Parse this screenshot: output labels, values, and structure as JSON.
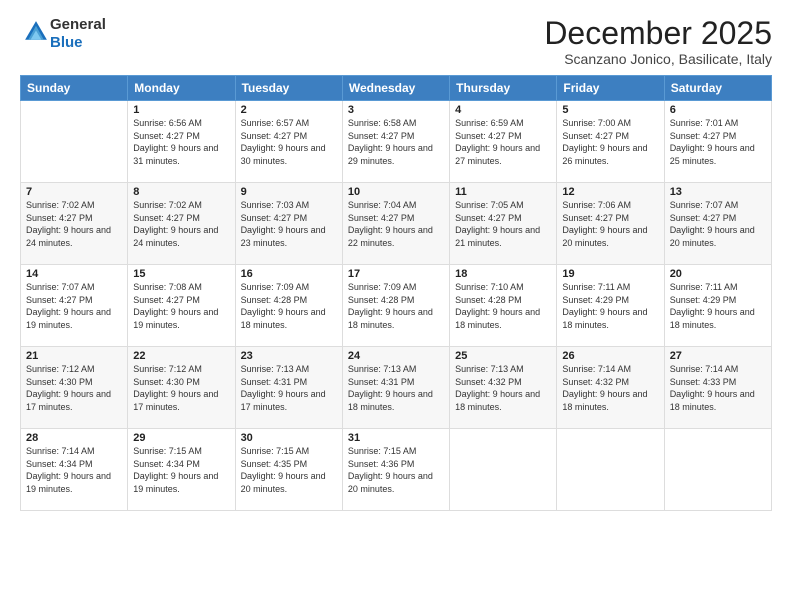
{
  "logo": {
    "general": "General",
    "blue": "Blue"
  },
  "title": "December 2025",
  "location": "Scanzano Jonico, Basilicate, Italy",
  "days_of_week": [
    "Sunday",
    "Monday",
    "Tuesday",
    "Wednesday",
    "Thursday",
    "Friday",
    "Saturday"
  ],
  "weeks": [
    [
      {
        "day": "",
        "sunrise": "",
        "sunset": "",
        "daylight": ""
      },
      {
        "day": "1",
        "sunrise": "Sunrise: 6:56 AM",
        "sunset": "Sunset: 4:27 PM",
        "daylight": "Daylight: 9 hours and 31 minutes."
      },
      {
        "day": "2",
        "sunrise": "Sunrise: 6:57 AM",
        "sunset": "Sunset: 4:27 PM",
        "daylight": "Daylight: 9 hours and 30 minutes."
      },
      {
        "day": "3",
        "sunrise": "Sunrise: 6:58 AM",
        "sunset": "Sunset: 4:27 PM",
        "daylight": "Daylight: 9 hours and 29 minutes."
      },
      {
        "day": "4",
        "sunrise": "Sunrise: 6:59 AM",
        "sunset": "Sunset: 4:27 PM",
        "daylight": "Daylight: 9 hours and 27 minutes."
      },
      {
        "day": "5",
        "sunrise": "Sunrise: 7:00 AM",
        "sunset": "Sunset: 4:27 PM",
        "daylight": "Daylight: 9 hours and 26 minutes."
      },
      {
        "day": "6",
        "sunrise": "Sunrise: 7:01 AM",
        "sunset": "Sunset: 4:27 PM",
        "daylight": "Daylight: 9 hours and 25 minutes."
      }
    ],
    [
      {
        "day": "7",
        "sunrise": "Sunrise: 7:02 AM",
        "sunset": "Sunset: 4:27 PM",
        "daylight": "Daylight: 9 hours and 24 minutes."
      },
      {
        "day": "8",
        "sunrise": "Sunrise: 7:02 AM",
        "sunset": "Sunset: 4:27 PM",
        "daylight": "Daylight: 9 hours and 24 minutes."
      },
      {
        "day": "9",
        "sunrise": "Sunrise: 7:03 AM",
        "sunset": "Sunset: 4:27 PM",
        "daylight": "Daylight: 9 hours and 23 minutes."
      },
      {
        "day": "10",
        "sunrise": "Sunrise: 7:04 AM",
        "sunset": "Sunset: 4:27 PM",
        "daylight": "Daylight: 9 hours and 22 minutes."
      },
      {
        "day": "11",
        "sunrise": "Sunrise: 7:05 AM",
        "sunset": "Sunset: 4:27 PM",
        "daylight": "Daylight: 9 hours and 21 minutes."
      },
      {
        "day": "12",
        "sunrise": "Sunrise: 7:06 AM",
        "sunset": "Sunset: 4:27 PM",
        "daylight": "Daylight: 9 hours and 20 minutes."
      },
      {
        "day": "13",
        "sunrise": "Sunrise: 7:07 AM",
        "sunset": "Sunset: 4:27 PM",
        "daylight": "Daylight: 9 hours and 20 minutes."
      }
    ],
    [
      {
        "day": "14",
        "sunrise": "Sunrise: 7:07 AM",
        "sunset": "Sunset: 4:27 PM",
        "daylight": "Daylight: 9 hours and 19 minutes."
      },
      {
        "day": "15",
        "sunrise": "Sunrise: 7:08 AM",
        "sunset": "Sunset: 4:27 PM",
        "daylight": "Daylight: 9 hours and 19 minutes."
      },
      {
        "day": "16",
        "sunrise": "Sunrise: 7:09 AM",
        "sunset": "Sunset: 4:28 PM",
        "daylight": "Daylight: 9 hours and 18 minutes."
      },
      {
        "day": "17",
        "sunrise": "Sunrise: 7:09 AM",
        "sunset": "Sunset: 4:28 PM",
        "daylight": "Daylight: 9 hours and 18 minutes."
      },
      {
        "day": "18",
        "sunrise": "Sunrise: 7:10 AM",
        "sunset": "Sunset: 4:28 PM",
        "daylight": "Daylight: 9 hours and 18 minutes."
      },
      {
        "day": "19",
        "sunrise": "Sunrise: 7:11 AM",
        "sunset": "Sunset: 4:29 PM",
        "daylight": "Daylight: 9 hours and 18 minutes."
      },
      {
        "day": "20",
        "sunrise": "Sunrise: 7:11 AM",
        "sunset": "Sunset: 4:29 PM",
        "daylight": "Daylight: 9 hours and 18 minutes."
      }
    ],
    [
      {
        "day": "21",
        "sunrise": "Sunrise: 7:12 AM",
        "sunset": "Sunset: 4:30 PM",
        "daylight": "Daylight: 9 hours and 17 minutes."
      },
      {
        "day": "22",
        "sunrise": "Sunrise: 7:12 AM",
        "sunset": "Sunset: 4:30 PM",
        "daylight": "Daylight: 9 hours and 17 minutes."
      },
      {
        "day": "23",
        "sunrise": "Sunrise: 7:13 AM",
        "sunset": "Sunset: 4:31 PM",
        "daylight": "Daylight: 9 hours and 17 minutes."
      },
      {
        "day": "24",
        "sunrise": "Sunrise: 7:13 AM",
        "sunset": "Sunset: 4:31 PM",
        "daylight": "Daylight: 9 hours and 18 minutes."
      },
      {
        "day": "25",
        "sunrise": "Sunrise: 7:13 AM",
        "sunset": "Sunset: 4:32 PM",
        "daylight": "Daylight: 9 hours and 18 minutes."
      },
      {
        "day": "26",
        "sunrise": "Sunrise: 7:14 AM",
        "sunset": "Sunset: 4:32 PM",
        "daylight": "Daylight: 9 hours and 18 minutes."
      },
      {
        "day": "27",
        "sunrise": "Sunrise: 7:14 AM",
        "sunset": "Sunset: 4:33 PM",
        "daylight": "Daylight: 9 hours and 18 minutes."
      }
    ],
    [
      {
        "day": "28",
        "sunrise": "Sunrise: 7:14 AM",
        "sunset": "Sunset: 4:34 PM",
        "daylight": "Daylight: 9 hours and 19 minutes."
      },
      {
        "day": "29",
        "sunrise": "Sunrise: 7:15 AM",
        "sunset": "Sunset: 4:34 PM",
        "daylight": "Daylight: 9 hours and 19 minutes."
      },
      {
        "day": "30",
        "sunrise": "Sunrise: 7:15 AM",
        "sunset": "Sunset: 4:35 PM",
        "daylight": "Daylight: 9 hours and 20 minutes."
      },
      {
        "day": "31",
        "sunrise": "Sunrise: 7:15 AM",
        "sunset": "Sunset: 4:36 PM",
        "daylight": "Daylight: 9 hours and 20 minutes."
      },
      {
        "day": "",
        "sunrise": "",
        "sunset": "",
        "daylight": ""
      },
      {
        "day": "",
        "sunrise": "",
        "sunset": "",
        "daylight": ""
      },
      {
        "day": "",
        "sunrise": "",
        "sunset": "",
        "daylight": ""
      }
    ]
  ]
}
